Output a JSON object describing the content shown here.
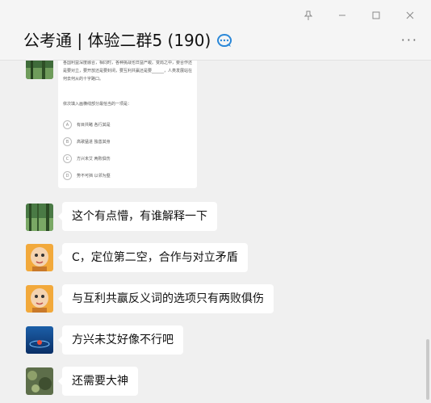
{
  "window": {
    "controls": [
      "pin-icon",
      "minimize-icon",
      "maximize-icon",
      "close-icon"
    ]
  },
  "header": {
    "title": "公考通 | 体验二群5 (190)",
    "title_icon": "chat-bubble-icon",
    "more": "···"
  },
  "image_message": {
    "question_text": "各国利益深度融合，相同时，各种挑战也日益严峻。变局之中，要合作还是要对立，要开放还是要封闭，要互利共赢还是要______，人类发展站在何去何从的十字路口。",
    "question_prompt": "依次填入画横线部分最恰当的一项是：",
    "options": [
      {
        "letter": "A",
        "text": "有目共睹 各行其是"
      },
      {
        "letter": "B",
        "text": "高歌猛进 独善其身"
      },
      {
        "letter": "C",
        "text": "方兴未艾 两败俱伤"
      },
      {
        "letter": "D",
        "text": "势不可挡 以邻为壑"
      }
    ]
  },
  "messages": [
    {
      "avatar": "forest-avatar",
      "text": "这个有点懵，有谁解释一下"
    },
    {
      "avatar": "cartoon-monk-avatar",
      "text": "C，定位第二空，合作与对立矛盾"
    },
    {
      "avatar": "cartoon-monk-avatar",
      "text": "与互利共赢反义词的选项只有两败俱伤"
    },
    {
      "avatar": "blue-water-avatar",
      "text": "方兴未艾好像不行吧"
    },
    {
      "avatar": "moss-avatar",
      "text": "还需要大神"
    }
  ],
  "colors": {
    "background": "#f0f0f0",
    "bubble": "#ffffff",
    "accent": "#2b88d8"
  }
}
